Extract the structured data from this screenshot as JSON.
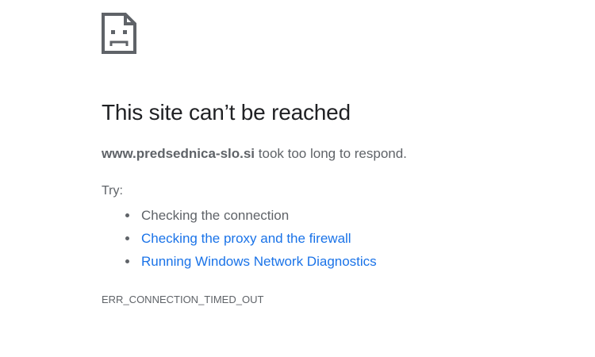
{
  "icon": "sad-page-icon",
  "title": "This site can’t be reached",
  "summary": {
    "host": "www.predsednica-slo.si",
    "message": " took too long to respond."
  },
  "try_label": "Try:",
  "suggestions": [
    {
      "label": "Checking the connection",
      "is_link": false
    },
    {
      "label": "Checking the proxy and the firewall",
      "is_link": true
    },
    {
      "label": "Running Windows Network Diagnostics",
      "is_link": true
    }
  ],
  "error_code": "ERR_CONNECTION_TIMED_OUT",
  "colors": {
    "text": "#5f6368",
    "heading": "#202124",
    "link": "#1a73e8",
    "background": "#ffffff"
  }
}
